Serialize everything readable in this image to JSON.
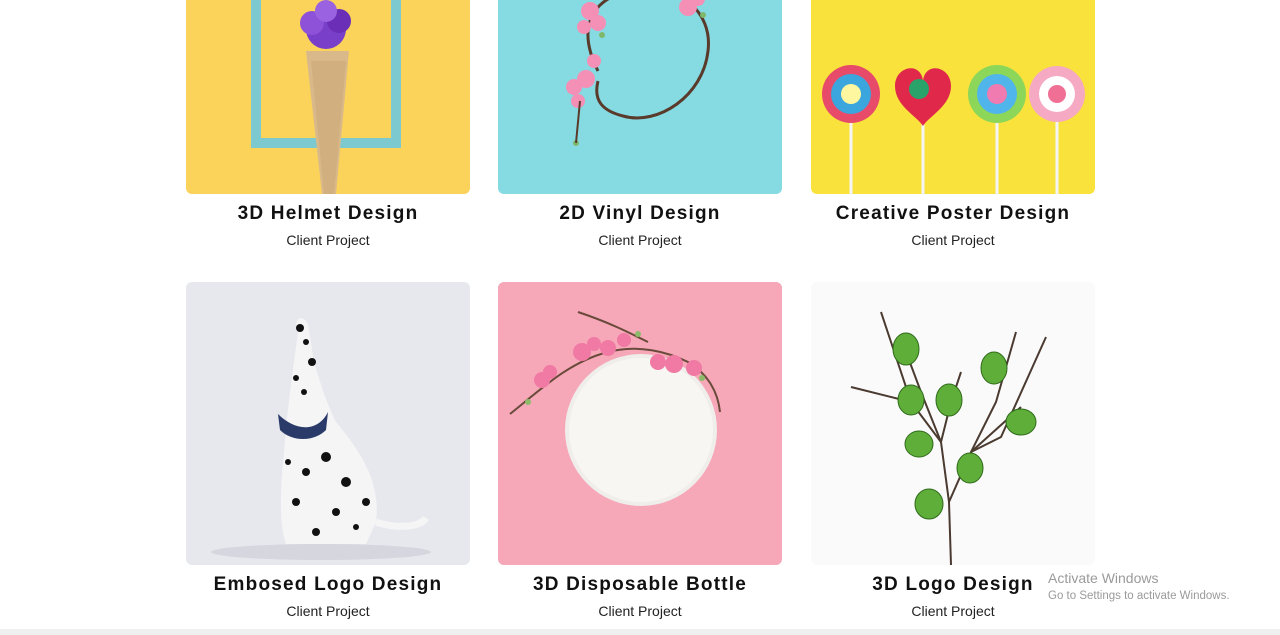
{
  "colors": {
    "yellow_bg": "#fbd35a",
    "aqua_bg": "#86dbe3",
    "lemon_bg": "#f9e23c",
    "grey_bg": "#e7e8ee",
    "pink_bg": "#f6a7b8",
    "white_bg": "#fafafa"
  },
  "projects": [
    {
      "title": "3D Helmet Design",
      "subtitle": "Client Project",
      "image": "flower-cone-frame-image"
    },
    {
      "title": "2D Vinyl Design",
      "subtitle": "Client Project",
      "image": "blossom-wreath-image"
    },
    {
      "title": "Creative Poster Design",
      "subtitle": "Client Project",
      "image": "lollipops-image"
    },
    {
      "title": "Embosed Logo Design",
      "subtitle": "Client Project",
      "image": "dalmatian-dog-image"
    },
    {
      "title": "3D Disposable Bottle",
      "subtitle": "Client Project",
      "image": "plate-blossom-image"
    },
    {
      "title": "3D Logo Design",
      "subtitle": "Client Project",
      "image": "branch-eggs-image"
    }
  ],
  "watermark": {
    "line1": "Activate Windows",
    "line2": "Go to Settings to activate Windows."
  }
}
